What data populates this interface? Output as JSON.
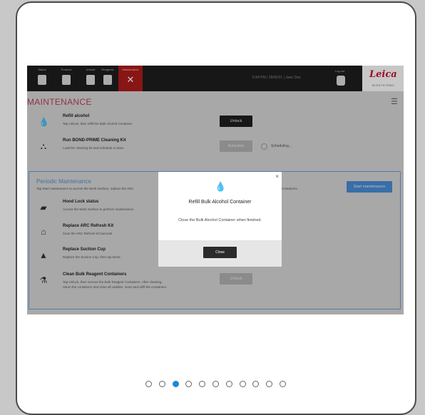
{
  "nav": {
    "items": [
      {
        "label": "Status",
        "icon": "status-icon"
      },
      {
        "label": "Protocol",
        "icon": "protocol-icon"
      },
      {
        "label": "Unload",
        "icon": "unload-icon"
      },
      {
        "label": "Reagents",
        "icon": "reagents-icon"
      },
      {
        "label": "Maintenance",
        "icon": "tools-icon",
        "active": true
      }
    ],
    "status_text": "5:44 PM  |  28/06/21  |  Jane Doe",
    "logout_label": "Log out",
    "brand": "Leica",
    "brand_sub": "BIOSYSTEMS"
  },
  "page": {
    "title": "MAINTENANCE"
  },
  "tasks": {
    "refill": {
      "title": "Refill alcohol",
      "desc": "Tap Unlock, then refill the Bulk Alcohol Container.",
      "button": "Unlock"
    },
    "bond": {
      "title": "Run BOND-PRIME Cleaning Kit",
      "desc": "Load the cleaning kit and schedule a clean.",
      "button": "Schedule",
      "status": "Scheduling..."
    }
  },
  "periodic": {
    "title": "Periodic Maintenance",
    "desc": "Tap Start maintenance to access the Work Surface, replace the ARC",
    "desc_tail": "Containers.",
    "button": "Start maintenance",
    "items": [
      {
        "title": "Hood Lock status",
        "desc": "Access the Work Surface to perform maintenance."
      },
      {
        "title": "Replace ARC Refresh Kit",
        "desc": "Scan the ARC Refresh Kit barcode."
      },
      {
        "title": "Replace Suction Cup",
        "desc": "Replace the Suction Cup, then tap Done."
      },
      {
        "title": "Clean Bulk Reagent Containers",
        "desc": "Tap Unlock, then remove the Bulk Reagent Containers. After cleaning,",
        "desc2": "return the containers and close all caddies. Scan and refill the containers."
      }
    ],
    "clean_button": "Unlock"
  },
  "dialog": {
    "title": "Refill Bulk Alcohol Container",
    "message": "Close the Bulk Alcohol Container when finished.",
    "button": "Close",
    "close_glyph": "×"
  },
  "pagination": {
    "total": 11,
    "active_index": 2
  },
  "colors": {
    "accent_red": "#b01c1c",
    "title_red": "#b9445a",
    "blue": "#4a8ed8",
    "drop_yellow": "#e3a21a",
    "dot_active": "#1a8ad4"
  }
}
